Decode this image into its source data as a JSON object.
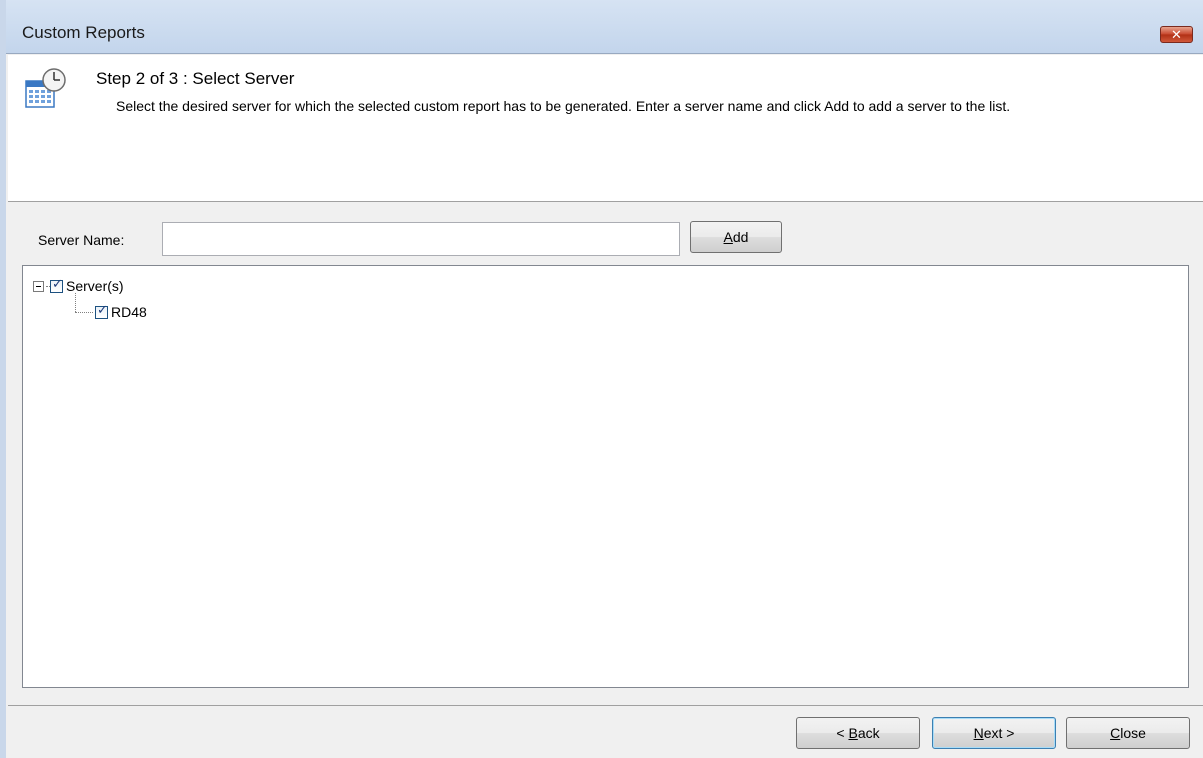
{
  "window": {
    "title": "Custom Reports",
    "close_glyph": "✕"
  },
  "step": {
    "title": "Step 2 of 3 : Select Server",
    "description": "Select the desired server for which the selected custom report has to be generated. Enter a server name and click Add to add a server to the list.",
    "icon": "calendar-clock-icon"
  },
  "server_input": {
    "label": "Server Name:",
    "value": "",
    "add_label_underlined": "A",
    "add_label_rest": "dd"
  },
  "tree": {
    "root": {
      "label": "Server(s)",
      "checked": true,
      "expanded": true
    },
    "children": [
      {
        "label": "RD48",
        "checked": true
      }
    ]
  },
  "buttons": {
    "back_prefix": "< ",
    "back_underlined": "B",
    "back_rest": "ack",
    "next_underlined": "N",
    "next_rest": "ext >",
    "close_underlined": "C",
    "close_rest": "lose"
  },
  "colors": {
    "title_bar": "#c3d5ec",
    "close_button": "#c7452b",
    "dialog_bg": "#f0f0f0"
  }
}
